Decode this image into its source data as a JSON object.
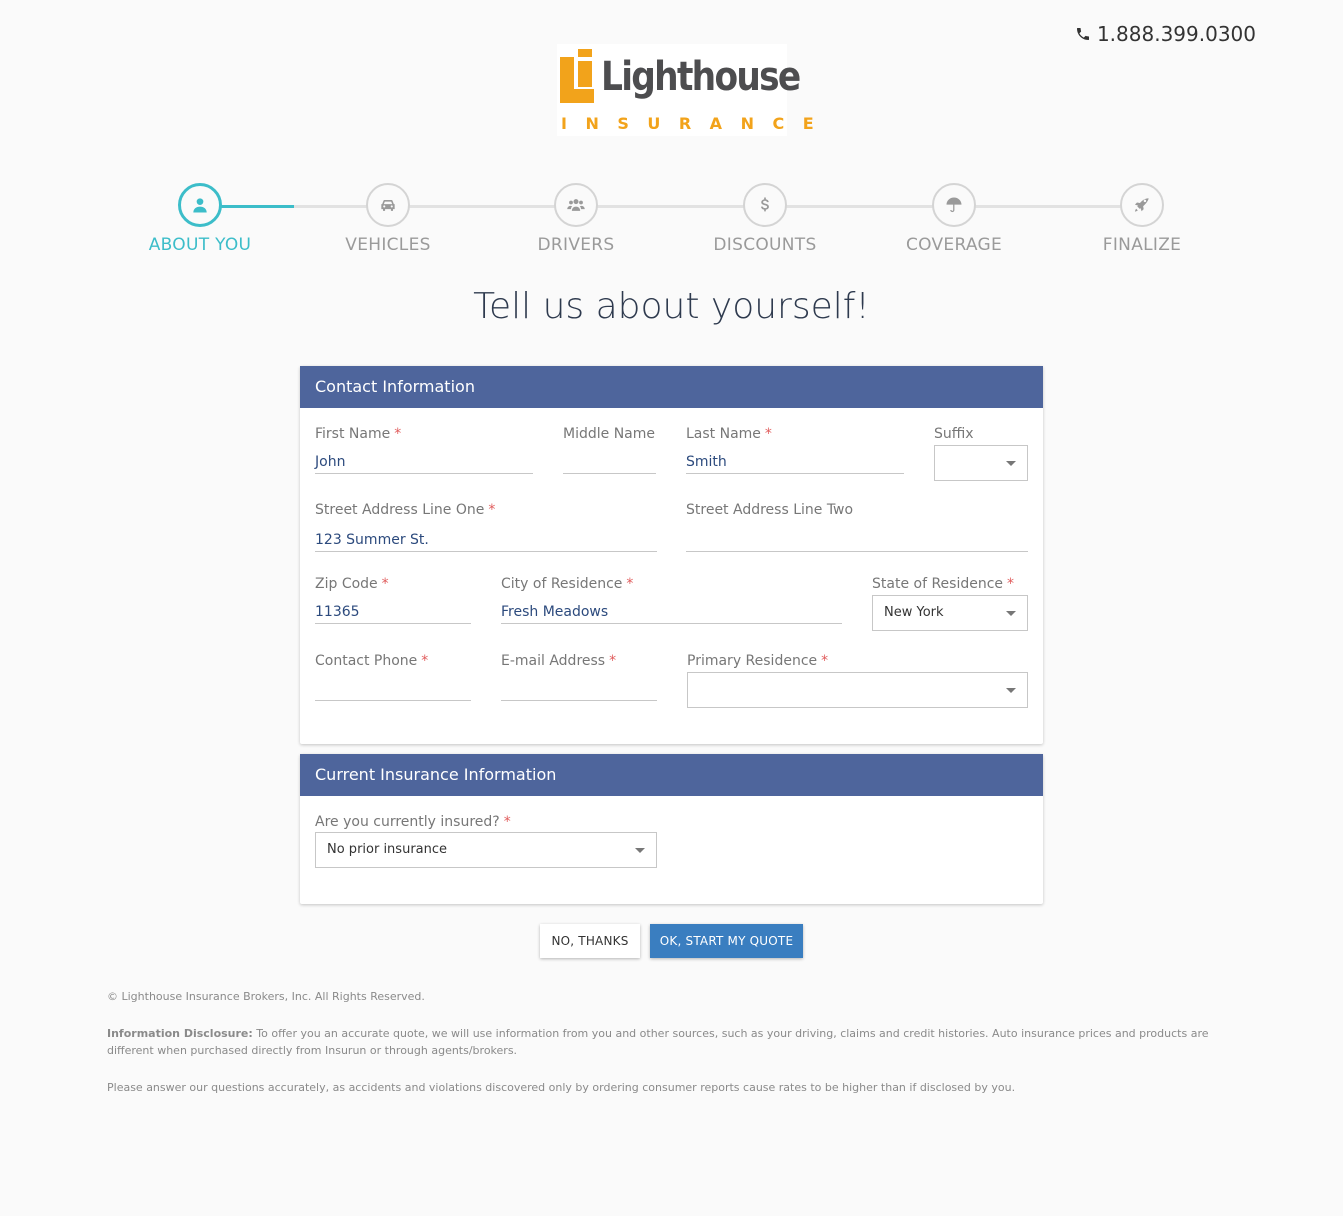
{
  "header": {
    "phone": "1.888.399.0300",
    "logo": {
      "wordmark": "Lighthouse",
      "subtitle": "INSURANCE"
    }
  },
  "colors": {
    "accent": "#3cbdc9",
    "panel_header": "#4e659c",
    "primary_button": "#3a7ec0",
    "required": "#e05b5b",
    "logo_orange": "#f2a31b"
  },
  "steps": [
    {
      "label": "ABOUT YOU",
      "icon": "user-icon"
    },
    {
      "label": "VEHICLES",
      "icon": "car-icon"
    },
    {
      "label": "DRIVERS",
      "icon": "users-icon"
    },
    {
      "label": "DISCOUNTS",
      "icon": "dollar-icon"
    },
    {
      "label": "COVERAGE",
      "icon": "umbrella-icon"
    },
    {
      "label": "FINALIZE",
      "icon": "rocket-icon"
    }
  ],
  "page_title": "Tell us about yourself!",
  "contact": {
    "title": "Contact Information",
    "first_name": {
      "label": "First Name",
      "value": "John"
    },
    "middle_name": {
      "label": "Middle Name",
      "value": ""
    },
    "last_name": {
      "label": "Last Name",
      "value": "Smith"
    },
    "suffix": {
      "label": "Suffix",
      "value": ""
    },
    "street1": {
      "label": "Street Address Line One",
      "value": "123 Summer St."
    },
    "street2": {
      "label": "Street Address Line Two",
      "value": ""
    },
    "zip": {
      "label": "Zip Code",
      "value": "11365"
    },
    "city": {
      "label": "City of Residence",
      "value": "Fresh Meadows"
    },
    "state": {
      "label": "State of Residence",
      "value": "New York"
    },
    "phone": {
      "label": "Contact Phone",
      "value": ""
    },
    "email": {
      "label": "E-mail Address",
      "value": ""
    },
    "primary_residence": {
      "label": "Primary Residence",
      "value": ""
    }
  },
  "insurance": {
    "title": "Current Insurance Information",
    "insured": {
      "label": "Are you currently insured?",
      "value": "No prior insurance"
    }
  },
  "buttons": {
    "no_thanks": "NO, THANKS",
    "start_quote": "OK, START MY QUOTE"
  },
  "footer": {
    "copyright": "© Lighthouse Insurance Brokers, Inc. All Rights Reserved.",
    "disclosure_title": "Information Disclosure:",
    "disclosure_text": " To offer you an accurate quote, we will use information from you and other sources, such as your driving, claims and credit histories. Auto insurance prices and products are different when purchased directly from Insurun or through agents/brokers.",
    "note": "Please answer our questions accurately, as accidents and violations discovered only by ordering consumer reports cause rates to be higher than if disclosed by you."
  }
}
